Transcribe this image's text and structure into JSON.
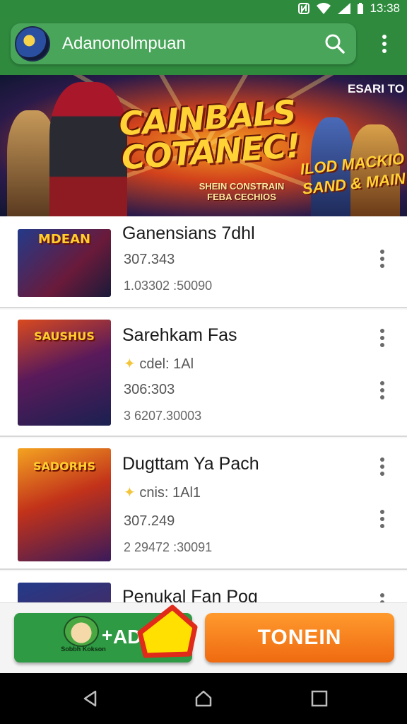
{
  "status_bar": {
    "time": "13:38"
  },
  "app_bar": {
    "title": "Adanonolmpuan",
    "search_icon": "search-icon",
    "more_icon": "more-vert-icon"
  },
  "banner": {
    "title_line1": "CAINBALS",
    "title_line2": "COTANEC!",
    "corner_text": "ESARI TO",
    "promo_line1": "ILOD MACKIO",
    "promo_line2": "SAND & MAIN",
    "sub_line1": "SHEIN CONSTRAIN",
    "sub_line2": "FEBA CECHIOS"
  },
  "games": [
    {
      "thumb_label": "MDEAN",
      "title": "Ganensians 7dhl",
      "line1": "307.343",
      "line2": "1.03302 :50090"
    },
    {
      "thumb_label": "SAUSHUS",
      "title": "Sarehkam Fas",
      "rating_text": "cdel: 1Al",
      "line1": "306:303",
      "line2": "3 6207.30003"
    },
    {
      "thumb_label": "SADORHS",
      "title": "Dugttam Ya Pach",
      "rating_text": "cnis: 1Al1",
      "line1": "307.249",
      "line2": "2 29472 :30091"
    },
    {
      "thumb_label": "",
      "title": "Penukal Fan Pog"
    }
  ],
  "actions": {
    "install_label": "ADD",
    "install_plus": "+",
    "install_tiny": "Sobbh Kokson",
    "primary_label": "TONEIN"
  },
  "colors": {
    "brand_green": "#2e8b3d",
    "accent_orange": "#ef6a10",
    "pointer_yellow": "#ffe000",
    "pointer_red": "#e02a1a"
  }
}
